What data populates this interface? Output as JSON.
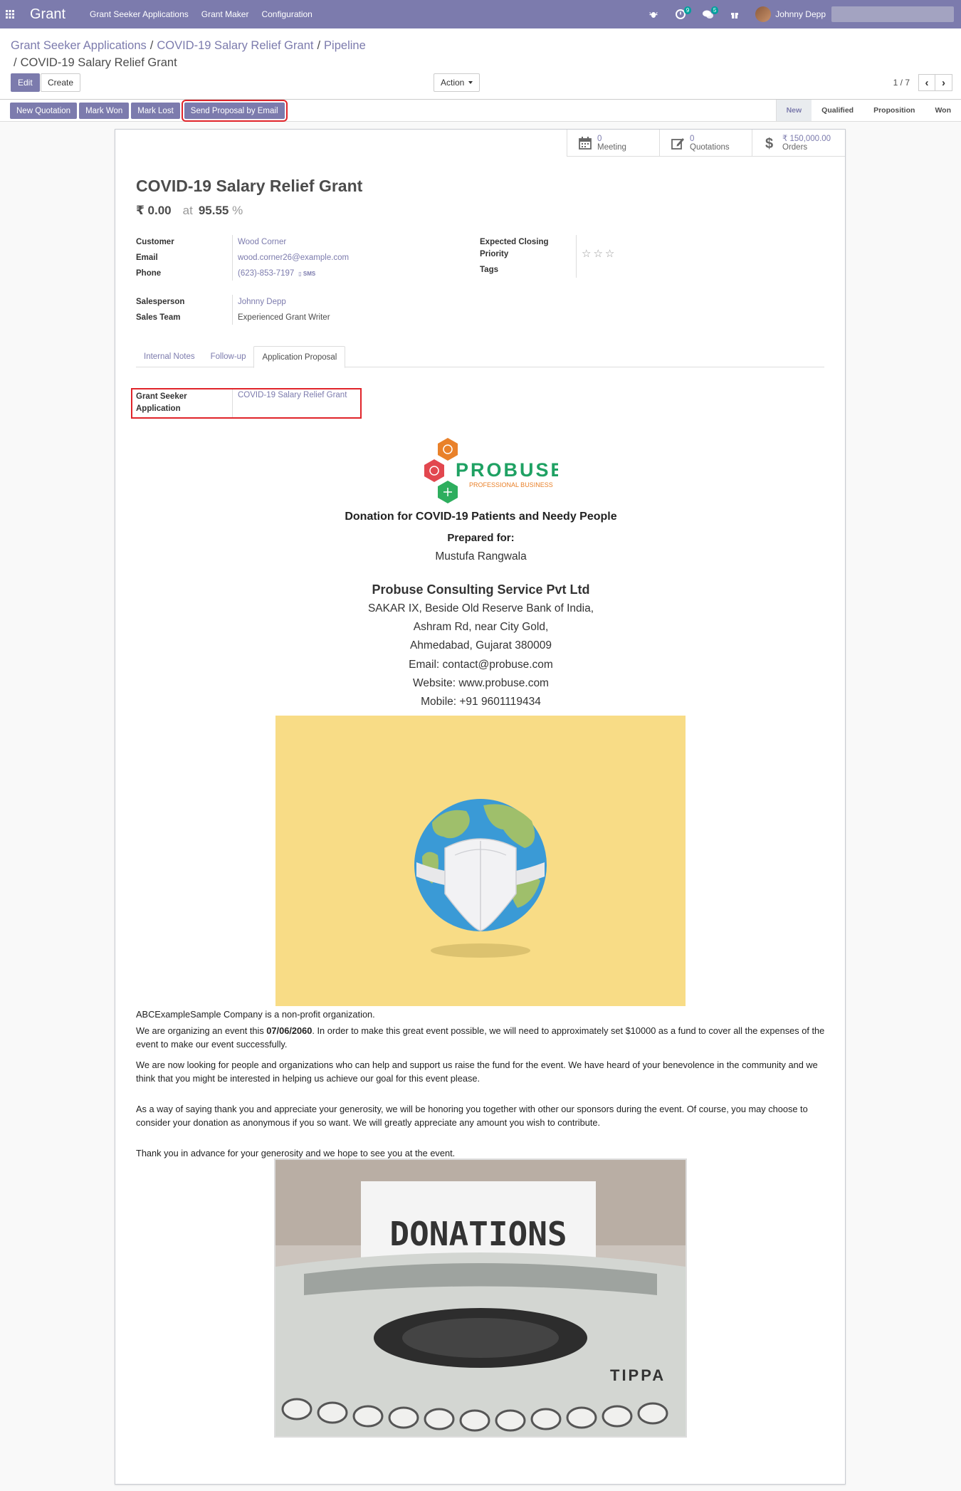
{
  "nav": {
    "brand": "Grant",
    "menu": [
      "Grant Seeker Applications",
      "Grant Maker",
      "Configuration"
    ],
    "badges": {
      "activity": "9",
      "messages": "5"
    },
    "user": "Johnny Depp"
  },
  "breadcrumb": {
    "items": [
      "Grant Seeker Applications",
      "COVID-19 Salary Relief Grant",
      "Pipeline"
    ],
    "active": "COVID-19 Salary Relief Grant"
  },
  "controls": {
    "edit": "Edit",
    "create": "Create",
    "action": "Action",
    "pager": "1 / 7"
  },
  "statusbar": {
    "buttons": [
      "New Quotation",
      "Mark Won",
      "Mark Lost",
      "Send Proposal by Email"
    ],
    "stages": [
      "New",
      "Qualified",
      "Proposition",
      "Won"
    ],
    "active_stage": "New"
  },
  "smart_buttons": [
    {
      "value": "0",
      "label": "Meeting",
      "icon": "calendar-icon"
    },
    {
      "value": "0",
      "label": "Quotations",
      "icon": "edit-icon"
    },
    {
      "value": "₹ 150,000.00",
      "label": "Orders",
      "icon": "dollar-icon"
    }
  ],
  "record": {
    "title": "COVID-19 Salary Relief Grant",
    "revenue": "₹ 0.00",
    "at": "at",
    "probability": "95.55",
    "pct": "%"
  },
  "fields": {
    "customer_label": "Customer",
    "customer": "Wood Corner",
    "email_label": "Email",
    "email": "wood.corner26@example.com",
    "phone_label": "Phone",
    "phone": "(623)-853-7197",
    "sms": "SMS",
    "salesperson_label": "Salesperson",
    "salesperson": "Johnny Depp",
    "team_label": "Sales Team",
    "team": "Experienced Grant Writer",
    "closing_label": "Expected Closing",
    "priority_label": "Priority",
    "tags_label": "Tags",
    "priority_stars": 0
  },
  "tabs": [
    "Internal Notes",
    "Follow-up",
    "Application Proposal"
  ],
  "active_tab": "Application Proposal",
  "gsa": {
    "label_line1": "Grant Seeker",
    "label_line2": "Application",
    "value": "COVID-19 Salary Relief Grant"
  },
  "proposal": {
    "logo_text": "PROBUSE",
    "logo_sub": "PROFESSIONAL BUSINESS",
    "heading": "Donation for COVID-19 Patients and Needy People",
    "prepared_for": "Prepared for:",
    "recipient": "Mustufa Rangwala",
    "company": "Probuse Consulting Service Pvt Ltd",
    "address": [
      "SAKAR IX, Beside Old Reserve Bank of India,",
      "Ashram Rd, near City Gold,",
      "Ahmedabad, Gujarat 380009",
      "Email: contact@probuse.com",
      "Website: www.probuse.com",
      "Mobile: +91 9601119434"
    ],
    "para1": "ABCExampleSample Company is a non-profit organization.",
    "para2_a": "We are organizing an event this ",
    "para2_date": "07/06/2060",
    "para2_b": ". In order to make this great event possible, we will need to approximately set $10000 as a fund to cover all the expenses of the event to make our event successfully.",
    "para3": "We are now looking for people and organizations who can help and support us raise the fund for the event. We have heard of your benevolence in the community and we think that you might be interested in helping us achieve our goal for this event please.",
    "para4": "As a way of saying thank you and appreciate your generosity, we will be honoring you together with other our sponsors during the event. Of course, you may choose to consider your donation as anonymous if you so want. We will greatly appreciate any amount you wish to contribute.",
    "para5": "Thank you in advance for your generosity and we hope to see you at the event.",
    "donation_sign": "DONATIONS",
    "typewriter_brand": "TIPPA"
  }
}
